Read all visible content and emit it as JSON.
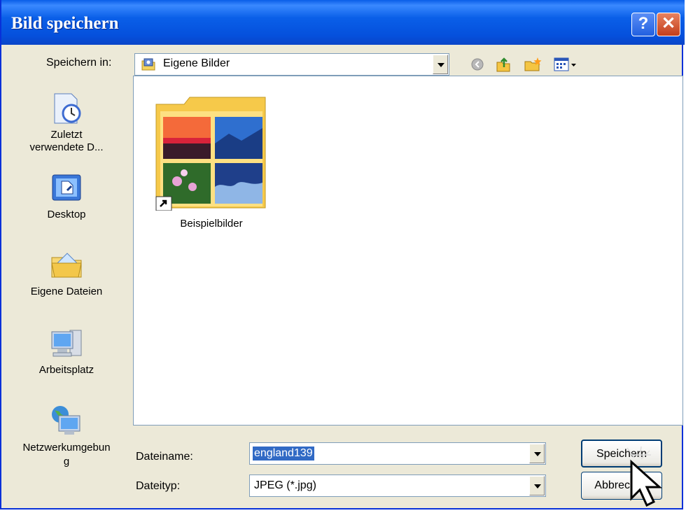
{
  "window": {
    "title": "Bild speichern"
  },
  "titlebar_buttons": {
    "help_label": "?",
    "close_label": "✕"
  },
  "save_in": {
    "label": "Speichern in:",
    "value": "Eigene Bilder"
  },
  "toolbar": {
    "icons": [
      "back-icon",
      "up-folder-icon",
      "new-folder-icon",
      "view-menu-icon"
    ]
  },
  "places": [
    {
      "label": "Zuletzt verwendete D...",
      "icon": "recent-documents-icon"
    },
    {
      "label": "Desktop",
      "icon": "desktop-icon"
    },
    {
      "label": "Eigene Dateien",
      "icon": "my-documents-icon"
    },
    {
      "label": "Arbeitsplatz",
      "icon": "my-computer-icon"
    },
    {
      "label": "Netzwerkumgebung",
      "icon": "network-icon"
    }
  ],
  "files": [
    {
      "name": "Beispielbilder",
      "type": "folder-shortcut"
    }
  ],
  "filename": {
    "label": "Dateiname:",
    "value": "england139"
  },
  "filetype": {
    "label": "Dateityp:",
    "value": "JPEG (*.jpg)"
  },
  "buttons": {
    "save": "Speichern",
    "cancel": "Abbrechen"
  },
  "colors": {
    "titlebar": "#0a5fe8",
    "dialog": "#ece9d8",
    "selection": "#316ac5"
  }
}
